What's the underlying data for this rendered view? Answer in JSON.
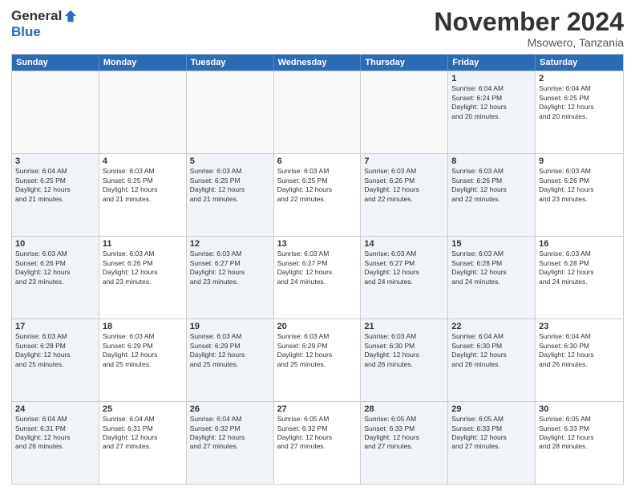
{
  "logo": {
    "general": "General",
    "blue": "Blue"
  },
  "header": {
    "month": "November 2024",
    "location": "Msowero, Tanzania"
  },
  "weekdays": [
    "Sunday",
    "Monday",
    "Tuesday",
    "Wednesday",
    "Thursday",
    "Friday",
    "Saturday"
  ],
  "rows": [
    [
      {
        "day": "",
        "info": "",
        "empty": true
      },
      {
        "day": "",
        "info": "",
        "empty": true
      },
      {
        "day": "",
        "info": "",
        "empty": true
      },
      {
        "day": "",
        "info": "",
        "empty": true
      },
      {
        "day": "",
        "info": "",
        "empty": true
      },
      {
        "day": "1",
        "info": "Sunrise: 6:04 AM\nSunset: 6:24 PM\nDaylight: 12 hours\nand 20 minutes.",
        "shaded": true
      },
      {
        "day": "2",
        "info": "Sunrise: 6:04 AM\nSunset: 6:25 PM\nDaylight: 12 hours\nand 20 minutes."
      }
    ],
    [
      {
        "day": "3",
        "info": "Sunrise: 6:04 AM\nSunset: 6:25 PM\nDaylight: 12 hours\nand 21 minutes.",
        "shaded": true
      },
      {
        "day": "4",
        "info": "Sunrise: 6:03 AM\nSunset: 6:25 PM\nDaylight: 12 hours\nand 21 minutes."
      },
      {
        "day": "5",
        "info": "Sunrise: 6:03 AM\nSunset: 6:25 PM\nDaylight: 12 hours\nand 21 minutes.",
        "shaded": true
      },
      {
        "day": "6",
        "info": "Sunrise: 6:03 AM\nSunset: 6:25 PM\nDaylight: 12 hours\nand 22 minutes."
      },
      {
        "day": "7",
        "info": "Sunrise: 6:03 AM\nSunset: 6:26 PM\nDaylight: 12 hours\nand 22 minutes.",
        "shaded": true
      },
      {
        "day": "8",
        "info": "Sunrise: 6:03 AM\nSunset: 6:26 PM\nDaylight: 12 hours\nand 22 minutes.",
        "shaded": true
      },
      {
        "day": "9",
        "info": "Sunrise: 6:03 AM\nSunset: 6:26 PM\nDaylight: 12 hours\nand 23 minutes."
      }
    ],
    [
      {
        "day": "10",
        "info": "Sunrise: 6:03 AM\nSunset: 6:26 PM\nDaylight: 12 hours\nand 23 minutes.",
        "shaded": true
      },
      {
        "day": "11",
        "info": "Sunrise: 6:03 AM\nSunset: 6:26 PM\nDaylight: 12 hours\nand 23 minutes."
      },
      {
        "day": "12",
        "info": "Sunrise: 6:03 AM\nSunset: 6:27 PM\nDaylight: 12 hours\nand 23 minutes.",
        "shaded": true
      },
      {
        "day": "13",
        "info": "Sunrise: 6:03 AM\nSunset: 6:27 PM\nDaylight: 12 hours\nand 24 minutes."
      },
      {
        "day": "14",
        "info": "Sunrise: 6:03 AM\nSunset: 6:27 PM\nDaylight: 12 hours\nand 24 minutes.",
        "shaded": true
      },
      {
        "day": "15",
        "info": "Sunrise: 6:03 AM\nSunset: 6:28 PM\nDaylight: 12 hours\nand 24 minutes.",
        "shaded": true
      },
      {
        "day": "16",
        "info": "Sunrise: 6:03 AM\nSunset: 6:28 PM\nDaylight: 12 hours\nand 24 minutes."
      }
    ],
    [
      {
        "day": "17",
        "info": "Sunrise: 6:03 AM\nSunset: 6:28 PM\nDaylight: 12 hours\nand 25 minutes.",
        "shaded": true
      },
      {
        "day": "18",
        "info": "Sunrise: 6:03 AM\nSunset: 6:29 PM\nDaylight: 12 hours\nand 25 minutes."
      },
      {
        "day": "19",
        "info": "Sunrise: 6:03 AM\nSunset: 6:29 PM\nDaylight: 12 hours\nand 25 minutes.",
        "shaded": true
      },
      {
        "day": "20",
        "info": "Sunrise: 6:03 AM\nSunset: 6:29 PM\nDaylight: 12 hours\nand 25 minutes."
      },
      {
        "day": "21",
        "info": "Sunrise: 6:03 AM\nSunset: 6:30 PM\nDaylight: 12 hours\nand 26 minutes.",
        "shaded": true
      },
      {
        "day": "22",
        "info": "Sunrise: 6:04 AM\nSunset: 6:30 PM\nDaylight: 12 hours\nand 26 minutes.",
        "shaded": true
      },
      {
        "day": "23",
        "info": "Sunrise: 6:04 AM\nSunset: 6:30 PM\nDaylight: 12 hours\nand 26 minutes."
      }
    ],
    [
      {
        "day": "24",
        "info": "Sunrise: 6:04 AM\nSunset: 6:31 PM\nDaylight: 12 hours\nand 26 minutes.",
        "shaded": true
      },
      {
        "day": "25",
        "info": "Sunrise: 6:04 AM\nSunset: 6:31 PM\nDaylight: 12 hours\nand 27 minutes."
      },
      {
        "day": "26",
        "info": "Sunrise: 6:04 AM\nSunset: 6:32 PM\nDaylight: 12 hours\nand 27 minutes.",
        "shaded": true
      },
      {
        "day": "27",
        "info": "Sunrise: 6:05 AM\nSunset: 6:32 PM\nDaylight: 12 hours\nand 27 minutes."
      },
      {
        "day": "28",
        "info": "Sunrise: 6:05 AM\nSunset: 6:33 PM\nDaylight: 12 hours\nand 27 minutes.",
        "shaded": true
      },
      {
        "day": "29",
        "info": "Sunrise: 6:05 AM\nSunset: 6:33 PM\nDaylight: 12 hours\nand 27 minutes.",
        "shaded": true
      },
      {
        "day": "30",
        "info": "Sunrise: 6:05 AM\nSunset: 6:33 PM\nDaylight: 12 hours\nand 28 minutes."
      }
    ]
  ]
}
